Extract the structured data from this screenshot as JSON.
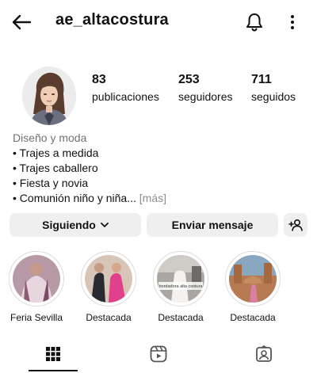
{
  "header": {
    "username": "ae_altacostura",
    "back_icon": "arrow-left-icon",
    "bell_icon": "bell-icon",
    "menu_icon": "more-vertical-icon"
  },
  "stats": [
    {
      "value": "83",
      "label": "publicaciones"
    },
    {
      "value": "253",
      "label": "seguidores"
    },
    {
      "value": "711",
      "label": "seguidos"
    }
  ],
  "bio": {
    "category": "Diseño y moda",
    "lines": [
      "• Trajes a medida",
      "• Trajes caballero",
      "• Fiesta y novia",
      "• Comunión niño y niña..."
    ],
    "more": "[más]"
  },
  "actions": {
    "following": "Siguiendo",
    "message": "Enviar mensaje",
    "add_user_icon": "add-person-icon"
  },
  "highlights": [
    {
      "label": "Feria Sevilla"
    },
    {
      "label": "Destacada"
    },
    {
      "label": "Destacada"
    },
    {
      "label": "Destacada"
    }
  ],
  "highlight_overlay_text": "bordadora alta costura",
  "tabs": [
    {
      "icon": "grid-icon",
      "active": true
    },
    {
      "icon": "reels-icon",
      "active": false
    },
    {
      "icon": "tagged-icon",
      "active": false
    }
  ],
  "colors": {
    "text": "#111111",
    "button_bg": "#efefef",
    "muted": "#737373",
    "ring": "#dbdbdb"
  }
}
